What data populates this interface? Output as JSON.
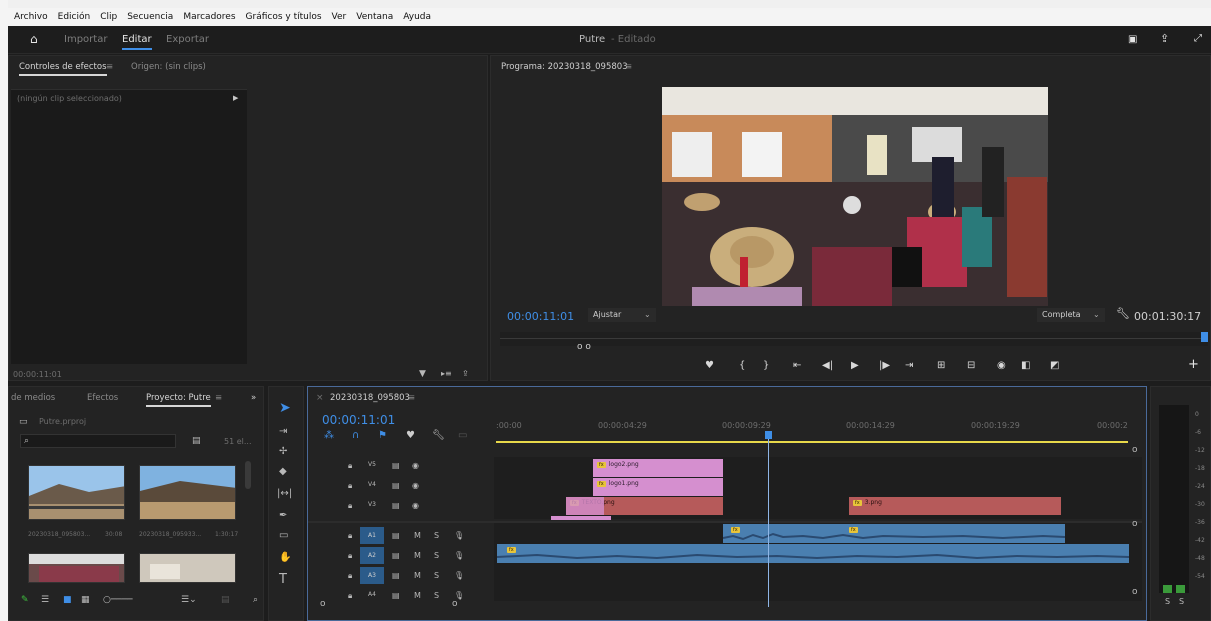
{
  "menu": [
    "Archivo",
    "Edición",
    "Clip",
    "Secuencia",
    "Marcadores",
    "Gráficos y títulos",
    "Ver",
    "Ventana",
    "Ayuda"
  ],
  "header": {
    "tabs": [
      "Importar",
      "Editar",
      "Exportar"
    ],
    "title": "Putre",
    "subtitle": "- Editado"
  },
  "effect_controls": {
    "tab_active": "Controles de efectos",
    "tab_menu": "≡",
    "tab_other": "Origen: (sin clips)",
    "empty_label": "(ningún clip seleccionado)",
    "timecode": "00:00:11:01"
  },
  "program": {
    "title": "Programa: 20230318_095803",
    "menu": "≡",
    "timecode": "00:00:11:01",
    "zoom": "Ajustar",
    "quality": "Completa",
    "duration": "00:01:30:17"
  },
  "project": {
    "tabs": [
      "de medios",
      "Efectos",
      "Proyecto: Putre"
    ],
    "menu": "≡",
    "more": "»",
    "file": "Putre.prproj",
    "count": "51 el...",
    "items": [
      {
        "name": "20230318_095803...",
        "dur": "30:08"
      },
      {
        "name": "20230318_095933...",
        "dur": "1:30:17"
      }
    ]
  },
  "timeline": {
    "sequence_tab": "20230318_095803",
    "menu": "≡",
    "close": "×",
    "timecode": "00:00:11:01",
    "ruler": [
      ":00:00",
      "00:00:04:29",
      "00:00:09:29",
      "00:00:14:29",
      "00:00:19:29",
      "00:00:2"
    ],
    "video_tracks": [
      "V5",
      "V4",
      "V3"
    ],
    "audio_tracks": [
      "A1",
      "A2",
      "A3",
      "A4"
    ],
    "mute_label": "M",
    "solo_label": "S",
    "clips": {
      "logo2": "logo2.png",
      "logo1": "logo1.png",
      "texto": "TEXTO.png",
      "t3": "3.png"
    },
    "fx_label": "fx"
  },
  "meter": {
    "scale": [
      "0",
      "-6",
      "-12",
      "-18",
      "-24",
      "-30",
      "-36",
      "-42",
      "-48",
      "-54"
    ],
    "solo": [
      "S",
      "S"
    ]
  },
  "colors": {
    "accent": "#3f8ee6",
    "clip_pink": "#d58fcf",
    "clip_red": "#b65a5a",
    "audio_blue": "#4a7fb0",
    "playhead": "#3f8ee6"
  }
}
